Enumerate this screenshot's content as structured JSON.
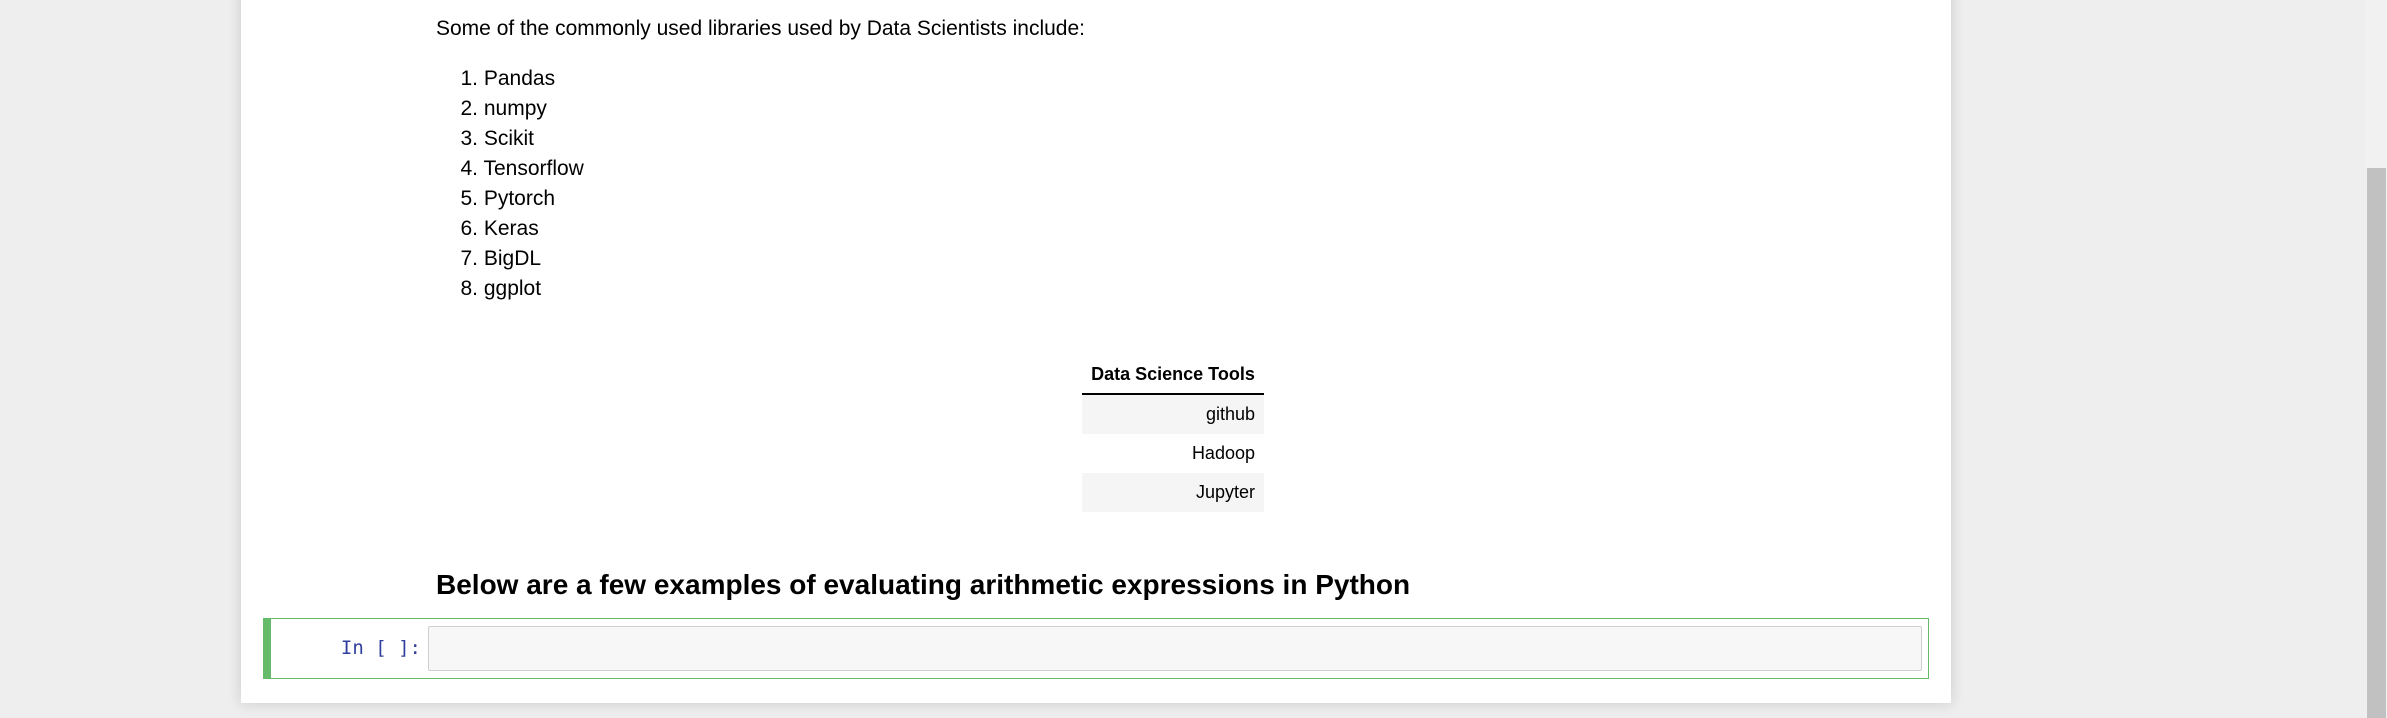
{
  "intro": {
    "text": "Some of the commonly used libraries used by Data Scientists include:"
  },
  "libraries": [
    {
      "number": "1.",
      "name": "Pandas"
    },
    {
      "number": "2.",
      "name": "numpy"
    },
    {
      "number": "3.",
      "name": "Scikit"
    },
    {
      "number": "4.",
      "name": "Tensorflow"
    },
    {
      "number": "5.",
      "name": "Pytorch"
    },
    {
      "number": "6.",
      "name": "Keras"
    },
    {
      "number": "7.",
      "name": "BigDL"
    },
    {
      "number": "8.",
      "name": "ggplot"
    }
  ],
  "tools_table": {
    "header": "Data Science Tools",
    "rows": [
      "github",
      "Hadoop",
      "Jupyter"
    ]
  },
  "section_heading": "Below are a few examples of evaluating arithmetic expressions in Python",
  "code_cell": {
    "prompt": "In [ ]:",
    "value": ""
  },
  "colors": {
    "selected_cell_border": "#66bb6a",
    "prompt_color": "#303f9f",
    "page_background": "#eeeeee",
    "table_stripe": "#f5f5f5"
  }
}
